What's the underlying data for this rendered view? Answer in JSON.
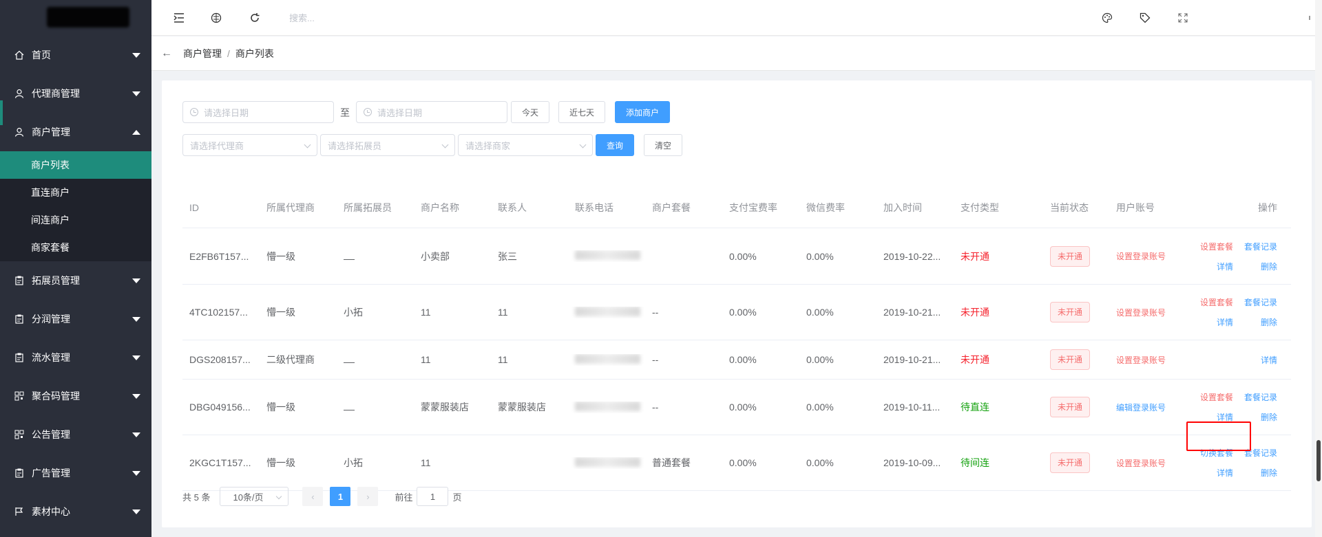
{
  "sidebar": {
    "items": [
      {
        "label": "首页",
        "icon": "home-icon"
      },
      {
        "label": "代理商管理",
        "icon": "user-icon"
      },
      {
        "label": "商户管理",
        "icon": "user-icon",
        "expanded": true
      },
      {
        "label": "拓展员管理",
        "icon": "clipboard-icon"
      },
      {
        "label": "分润管理",
        "icon": "clipboard-icon"
      },
      {
        "label": "流水管理",
        "icon": "clipboard-icon"
      },
      {
        "label": "聚合码管理",
        "icon": "qrcode-icon"
      },
      {
        "label": "公告管理",
        "icon": "qrcode-icon"
      },
      {
        "label": "广告管理",
        "icon": "clipboard-icon"
      },
      {
        "label": "素材中心",
        "icon": "flag-icon"
      }
    ],
    "subitems": [
      "商户列表",
      "直连商户",
      "间连商户",
      "商家套餐"
    ]
  },
  "header": {
    "search_placeholder": "搜索..."
  },
  "breadcrumb": {
    "parent": "商户管理",
    "current": "商户列表"
  },
  "filters": {
    "date_placeholder": "请选择日期",
    "to_label": "至",
    "today": "今天",
    "last7": "近七天",
    "add": "添加商户",
    "agent_placeholder": "请选择代理商",
    "expander_placeholder": "请选择拓展员",
    "merchant_placeholder": "请选择商家",
    "query": "查询",
    "clear": "清空"
  },
  "table": {
    "headers": [
      "ID",
      "所属代理商",
      "所属拓展员",
      "商户名称",
      "联系人",
      "联系电话",
      "商户套餐",
      "支付宝费率",
      "微信费率",
      "加入时间",
      "支付类型",
      "当前状态",
      "用户账号",
      "操作"
    ],
    "rows": [
      {
        "id": "E2FB6T157...",
        "agent": "懵一级",
        "expander": "",
        "name": "小卖部",
        "contact": "张三",
        "package": "",
        "alipay": "0.00%",
        "wechat": "0.00%",
        "joined": "2019-10-22...",
        "paytype": "未开通",
        "status": "未开通",
        "account": "设置登录账号",
        "ops": [
          "设置套餐",
          "套餐记录",
          "详情",
          "删除"
        ]
      },
      {
        "id": "4TC102157...",
        "agent": "懵一级",
        "expander": "小拓",
        "name": "11",
        "contact": "11",
        "package": "--",
        "alipay": "0.00%",
        "wechat": "0.00%",
        "joined": "2019-10-21...",
        "paytype": "未开通",
        "status": "未开通",
        "account": "设置登录账号",
        "ops": [
          "设置套餐",
          "套餐记录",
          "详情",
          "删除"
        ]
      },
      {
        "id": "DGS208157...",
        "agent": "二级代理商",
        "expander": "",
        "name": "11",
        "contact": "11",
        "package": "--",
        "alipay": "0.00%",
        "wechat": "0.00%",
        "joined": "2019-10-21...",
        "paytype": "未开通",
        "status": "未开通",
        "account": "设置登录账号",
        "ops": [
          "详情"
        ]
      },
      {
        "id": "DBG049156...",
        "agent": "懵一级",
        "expander": "",
        "name": "蒙蒙服装店",
        "contact": "蒙蒙服装店",
        "package": "--",
        "alipay": "0.00%",
        "wechat": "0.00%",
        "joined": "2019-10-11...",
        "paytype": "待直连",
        "status": "未开通",
        "account": "编辑登录账号",
        "ops": [
          "设置套餐",
          "套餐记录",
          "详情",
          "删除"
        ]
      },
      {
        "id": "2KGC1T157...",
        "agent": "懵一级",
        "expander": "小拓",
        "name": "11",
        "contact": "",
        "package": "普通套餐",
        "alipay": "0.00%",
        "wechat": "0.00%",
        "joined": "2019-10-09...",
        "paytype": "待间连",
        "status": "未开通",
        "account": "设置登录账号",
        "ops": [
          "切换套餐",
          "套餐记录",
          "详情",
          "删除"
        ]
      }
    ]
  },
  "pagination": {
    "total": "共 5 条",
    "page_size": "10条/页",
    "current": "1",
    "goto_label": "前往",
    "goto_value": "1",
    "page_label": "页"
  },
  "colors": {
    "sidebar_bg": "#2b2f3a",
    "active_teal": "#1e8c7c",
    "primary": "#409eff",
    "danger": "#f56c6c",
    "success": "#13a10e"
  }
}
